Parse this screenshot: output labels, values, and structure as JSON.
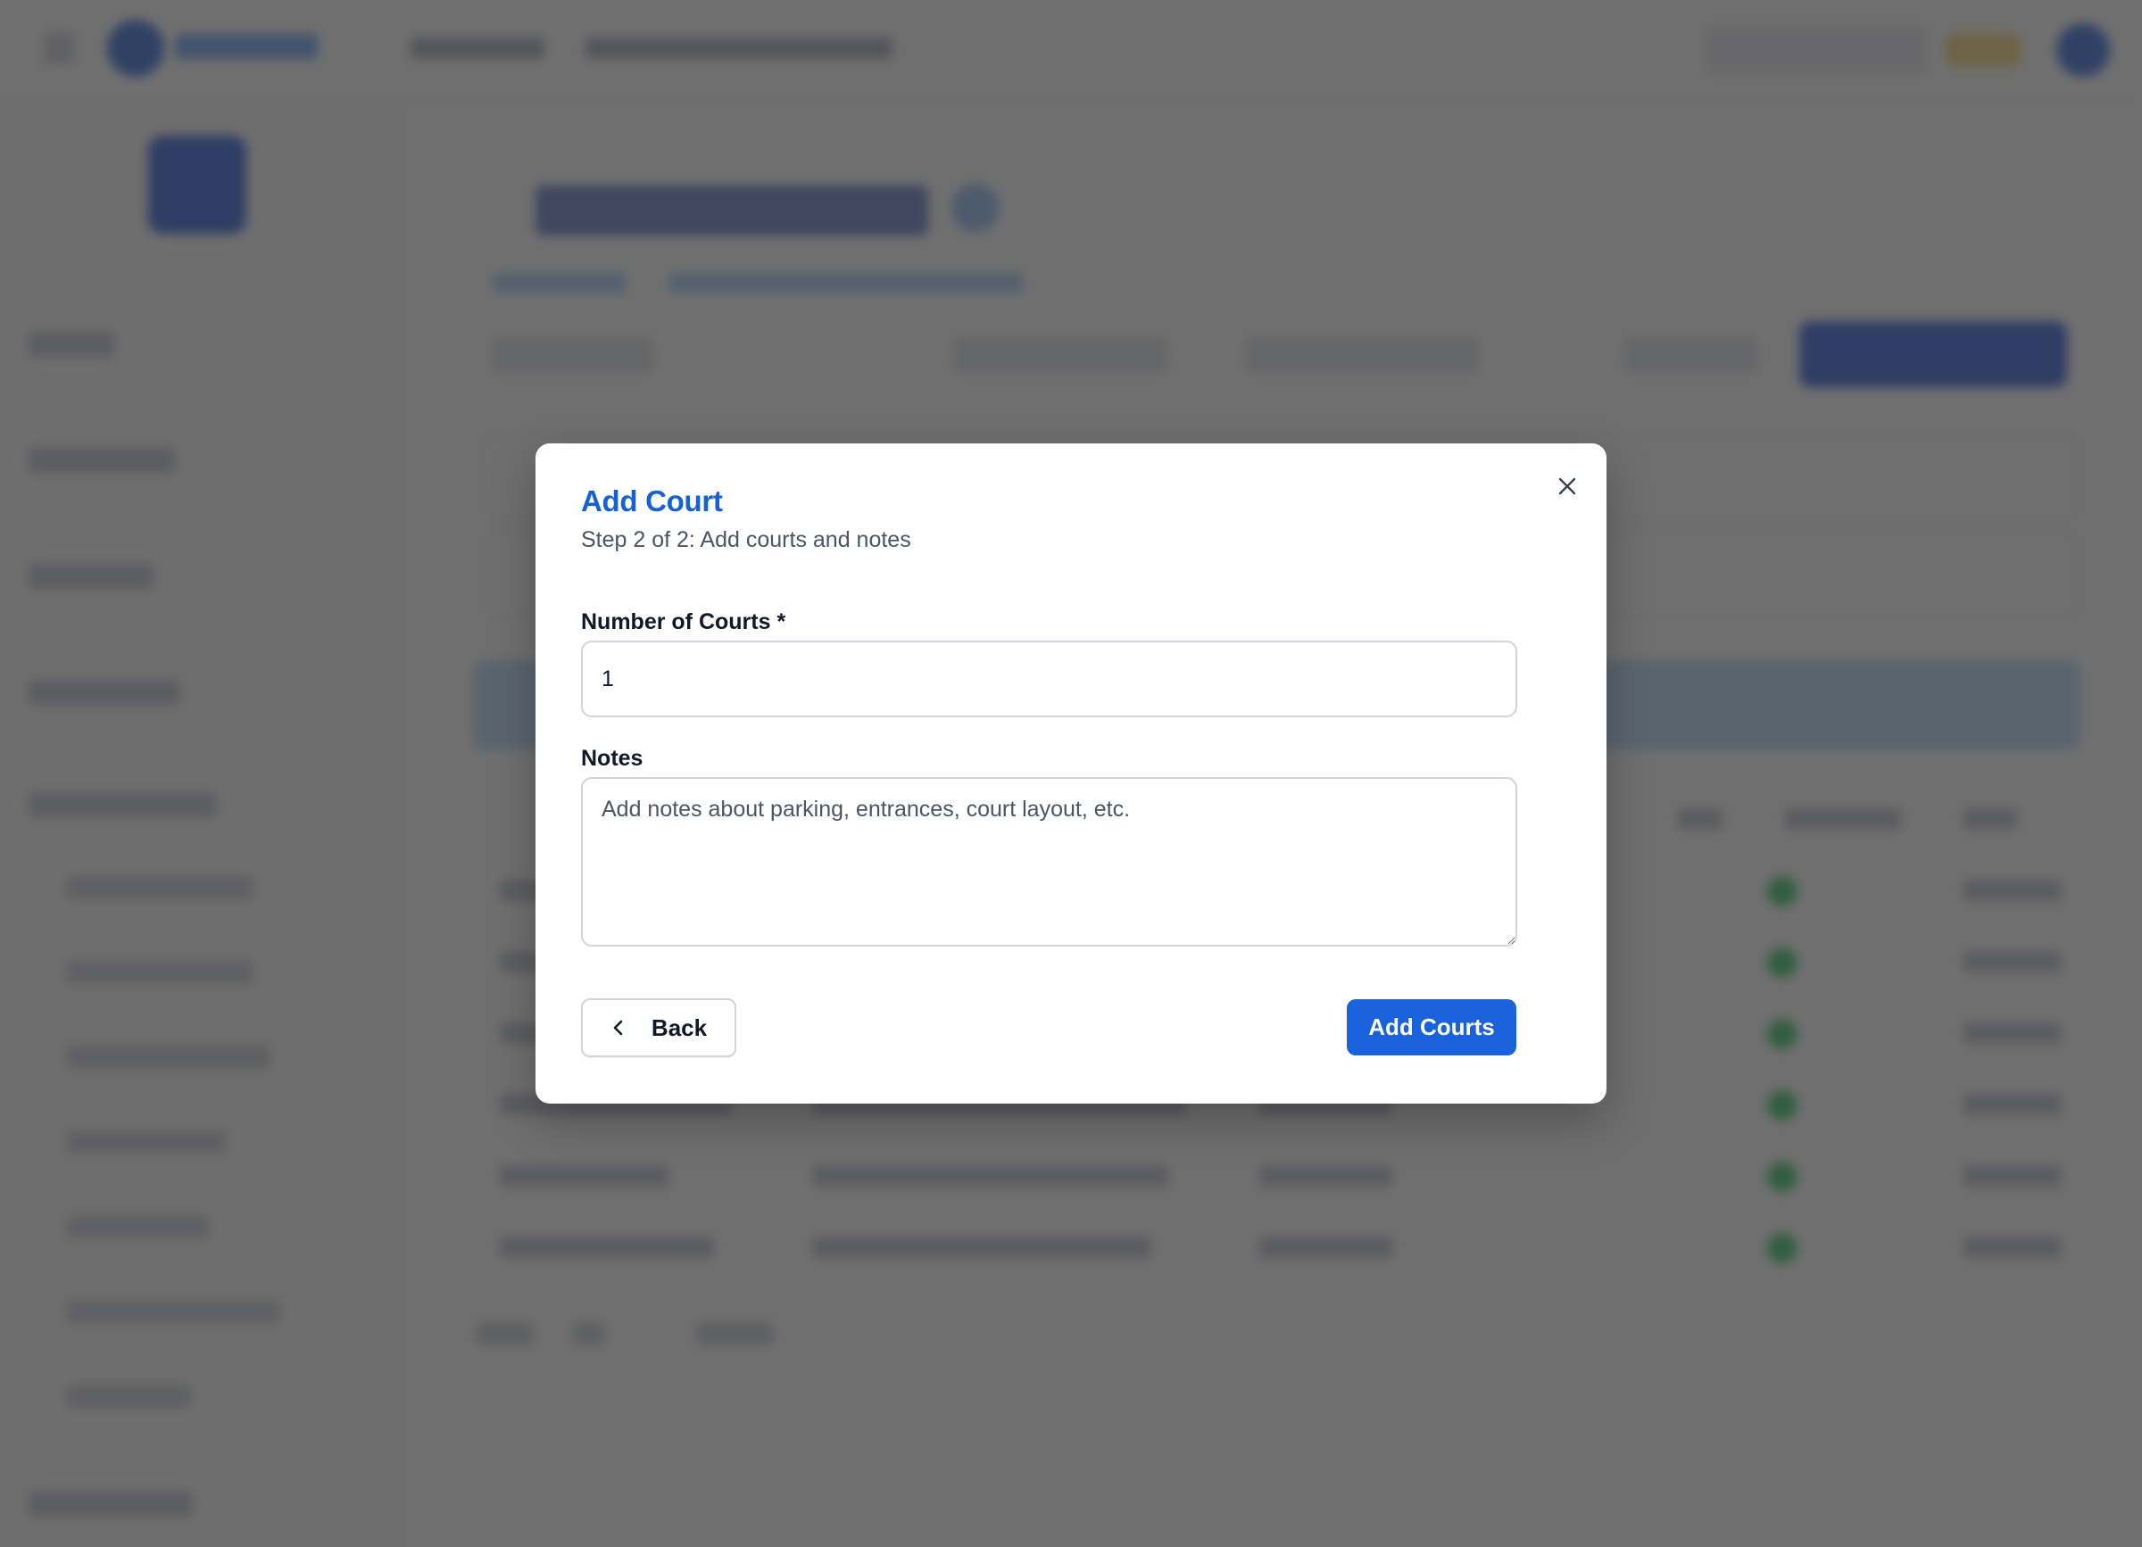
{
  "modal": {
    "title": "Add Court",
    "subtitle": "Step 2 of 2: Add courts and notes",
    "close_icon": "close-icon",
    "fields": {
      "courts": {
        "label": "Number of Courts *",
        "value": "1"
      },
      "notes": {
        "label": "Notes",
        "value": "",
        "placeholder": "Add notes about parking, entrances, court layout, etc."
      }
    },
    "buttons": {
      "back_label": "Back",
      "back_icon": "chevron-left-icon",
      "submit_label": "Add Courts"
    }
  },
  "colors": {
    "accent": "#1a62dc",
    "title": "#1760d6",
    "overlay": "rgba(56,56,56,0.72)"
  }
}
